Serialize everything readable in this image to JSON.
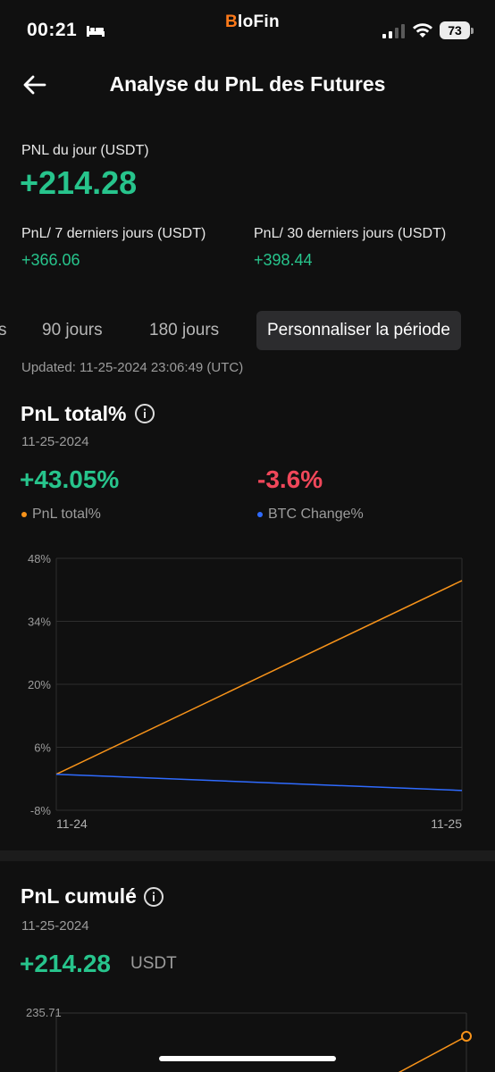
{
  "status_bar": {
    "time": "00:21",
    "brand_b": "B",
    "brand_rest": "loFin",
    "battery": "73"
  },
  "header": {
    "title": "Analyse du PnL des Futures"
  },
  "summary": {
    "daily_label": "PNL du jour (USDT)",
    "daily_value": "+214.28",
    "week_label": "PnL/ 7 derniers jours (USDT)",
    "week_value": "+366.06",
    "month_label": "PnL/ 30 derniers jours (USDT)",
    "month_value": "+398.44"
  },
  "tabs": {
    "partial": "s",
    "items": [
      {
        "label": "90 jours"
      },
      {
        "label": "180 jours"
      },
      {
        "label": "Personnaliser la période",
        "active": true
      }
    ]
  },
  "updated": "Updated: 11-25-2024 23:06:49 (UTC)",
  "total_pnl": {
    "title": "PnL total%",
    "date": "11-25-2024",
    "pnl_value": "+43.05%",
    "pnl_legend": "PnL total%",
    "btc_value": "-3.6%",
    "btc_legend": "BTC Change%"
  },
  "cumulative": {
    "title": "PnL cumulé",
    "date": "11-25-2024",
    "value": "+214.28",
    "unit": "USDT",
    "axis_top": "235.71"
  },
  "colors": {
    "green": "#27c48c",
    "red": "#f0475a",
    "orange": "#f7931a",
    "blue": "#2f6bff"
  },
  "chart_data": {
    "type": "line",
    "x": [
      "11-24",
      "11-25"
    ],
    "y_ticks": [
      "48%",
      "34%",
      "20%",
      "6%",
      "-8%"
    ],
    "y_tick_values": [
      48,
      34,
      20,
      6,
      -8
    ],
    "ylim": [
      -8,
      48
    ],
    "series": [
      {
        "name": "PnL total%",
        "color": "#f7931a",
        "values": [
          0,
          43.05
        ]
      },
      {
        "name": "BTC Change%",
        "color": "#2f6bff",
        "values": [
          0,
          -3.6
        ]
      }
    ]
  }
}
